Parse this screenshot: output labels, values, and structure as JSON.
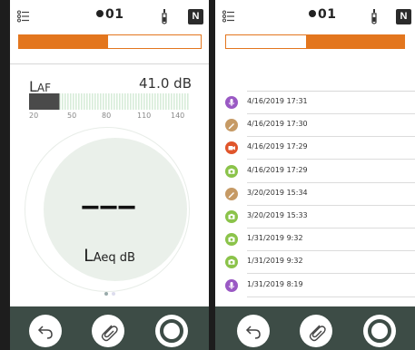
{
  "colors": {
    "accent": "#e3761e",
    "toolbar": "#3d4c46",
    "dial": "#eaf0ea",
    "video": "#e0552b",
    "photo": "#8bc34a",
    "note": "#c69a65",
    "voice": "#9a59c4"
  },
  "left": {
    "status": {
      "count": "01",
      "badge": "N",
      "progress_fraction": 0.49
    },
    "meter": {
      "label_big": "L",
      "label_small": "AF",
      "value": "41.0 dB",
      "level_fraction": 0.19,
      "scale": [
        "20",
        "50",
        "80",
        "110",
        "140"
      ]
    },
    "reading": {
      "value": "———",
      "unit_big": "L",
      "unit_small": "Aeq dB"
    },
    "pages": {
      "count": 2,
      "active": 0
    }
  },
  "right": {
    "status": {
      "count": "01",
      "badge": "N",
      "progress_fraction": 0.55
    },
    "items": [
      {
        "type": "voice",
        "icon": "mic-icon",
        "timestamp": "4/16/2019 17:31"
      },
      {
        "type": "note",
        "icon": "pencil-icon",
        "timestamp": "4/16/2019 17:30"
      },
      {
        "type": "video",
        "icon": "video-camera-icon",
        "timestamp": "4/16/2019 17:29"
      },
      {
        "type": "photo",
        "icon": "camera-icon",
        "timestamp": "4/16/2019 17:29"
      },
      {
        "type": "note",
        "icon": "pencil-icon",
        "timestamp": "3/20/2019 15:34"
      },
      {
        "type": "photo",
        "icon": "camera-icon",
        "timestamp": "3/20/2019 15:33"
      },
      {
        "type": "photo",
        "icon": "camera-icon",
        "timestamp": "1/31/2019 9:32"
      },
      {
        "type": "photo",
        "icon": "camera-icon",
        "timestamp": "1/31/2019 9:32"
      },
      {
        "type": "voice",
        "icon": "mic-icon",
        "timestamp": "1/31/2019 8:19"
      }
    ]
  },
  "toolbar": {
    "buttons": [
      {
        "icon": "undo-icon"
      },
      {
        "icon": "paperclip-icon"
      },
      {
        "icon": "record-icon"
      }
    ]
  }
}
